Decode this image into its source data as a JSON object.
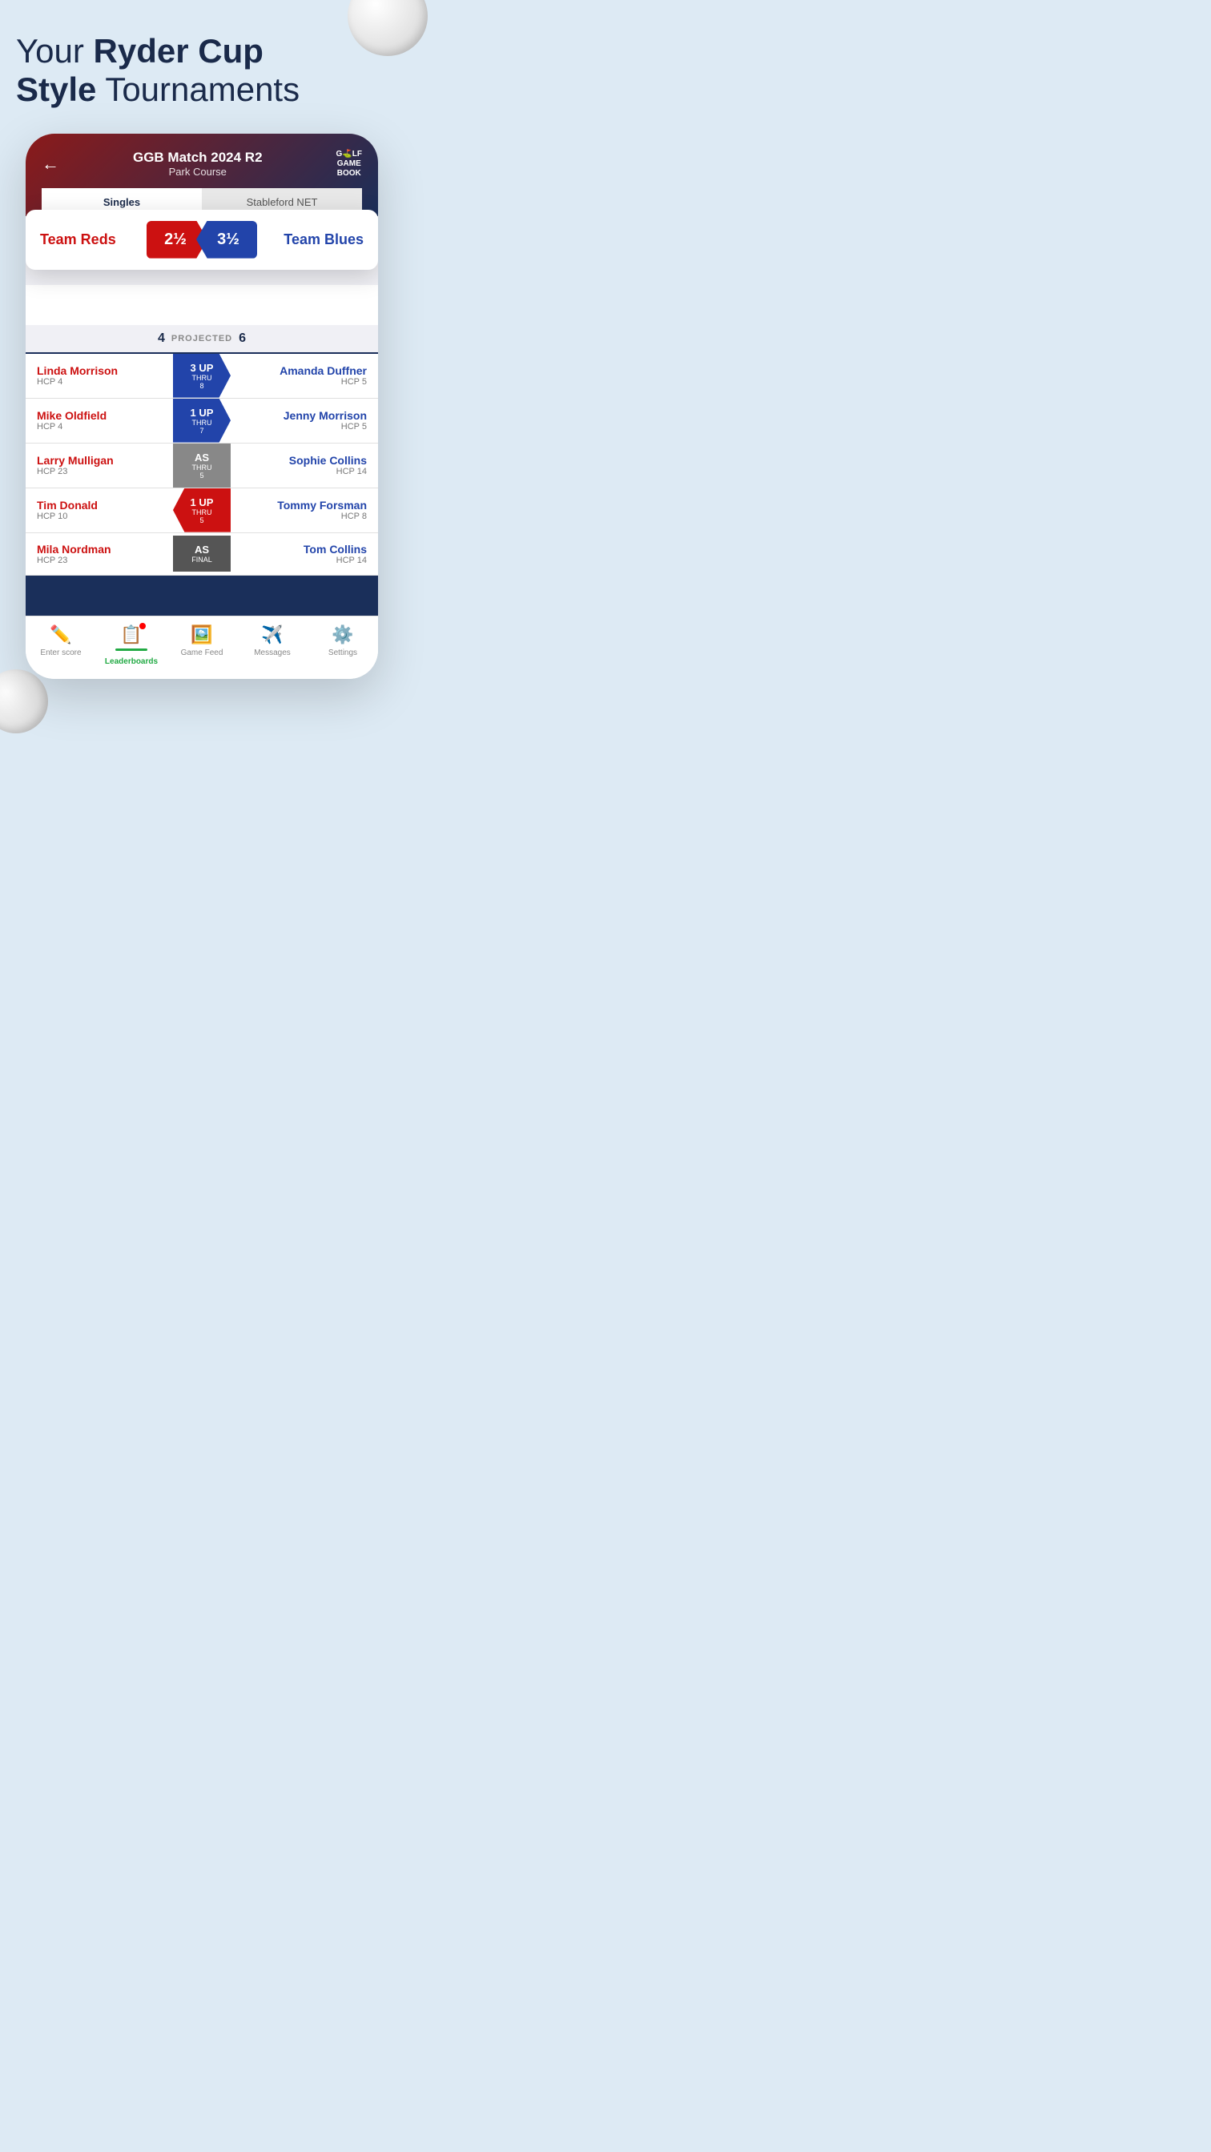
{
  "page": {
    "headline_normal": "Your ",
    "headline_bold1": "Ryder Cup",
    "headline_normal2": " Style ",
    "headline_bold2": "Tournaments"
  },
  "app": {
    "match_title": "GGB Match 2024 R2",
    "course": "Park Course",
    "logo_line1": "G⛳LF",
    "logo_line2": "GAME",
    "logo_line3": "BOOK"
  },
  "tabs": [
    {
      "label": "Singles",
      "active": true
    },
    {
      "label": "Stableford NET",
      "active": false
    }
  ],
  "score": {
    "team_red_name": "Team Reds",
    "team_red_score": "2½",
    "team_blue_score": "3½",
    "team_blue_name": "Team Blues"
  },
  "projected": {
    "red_proj": "4",
    "label": "PROJECTED",
    "blue_proj": "6"
  },
  "matches": [
    {
      "left_name": "Linda Morrison",
      "left_hcp": "HCP 4",
      "badge_type": "blue",
      "score_main": "3 UP",
      "score_sub": "THRU",
      "score_hole": "8",
      "right_name": "Amanda Duffner",
      "right_hcp": "HCP 5"
    },
    {
      "left_name": "Mike Oldfield",
      "left_hcp": "HCP 4",
      "badge_type": "blue",
      "score_main": "1 UP",
      "score_sub": "THRU",
      "score_hole": "7",
      "right_name": "Jenny Morrison",
      "right_hcp": "HCP 5"
    },
    {
      "left_name": "Larry Mulligan",
      "left_hcp": "HCP 23",
      "badge_type": "gray",
      "score_main": "AS",
      "score_sub": "THRU",
      "score_hole": "5",
      "right_name": "Sophie Collins",
      "right_hcp": "HCP 14"
    },
    {
      "left_name": "Tim Donald",
      "left_hcp": "HCP 10",
      "badge_type": "red",
      "score_main": "1 UP",
      "score_sub": "THRU",
      "score_hole": "5",
      "right_name": "Tommy Forsman",
      "right_hcp": "HCP 8"
    },
    {
      "left_name": "Mila Nordman",
      "left_hcp": "HCP 23",
      "badge_type": "dark",
      "score_main": "AS",
      "score_sub": "FINAL",
      "score_hole": "",
      "right_name": "Tom Collins",
      "right_hcp": "HCP 14"
    }
  ],
  "nav": [
    {
      "icon": "✏️",
      "label": "Enter score",
      "active": false
    },
    {
      "icon": "📋",
      "label": "Leaderboards",
      "active": true,
      "badge": true
    },
    {
      "icon": "🖼️",
      "label": "Game Feed",
      "active": false
    },
    {
      "icon": "✈️",
      "label": "Messages",
      "active": false
    },
    {
      "icon": "⚙️",
      "label": "Settings",
      "active": false
    }
  ]
}
